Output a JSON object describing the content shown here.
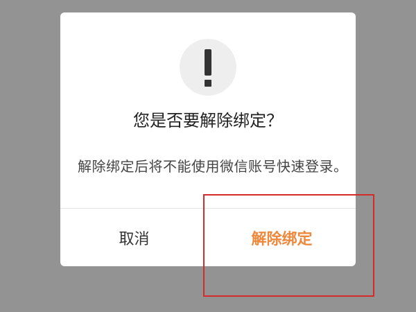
{
  "dialog": {
    "icon": "exclamation-icon",
    "title": "您是否要解除绑定？",
    "message": "解除绑定后将不能使用微信账号快速登录。",
    "cancel_label": "取消",
    "confirm_label": "解除绑定"
  },
  "colors": {
    "backdrop": "#939393",
    "confirm": "#f0883c",
    "highlight_border": "#d42a2a"
  }
}
